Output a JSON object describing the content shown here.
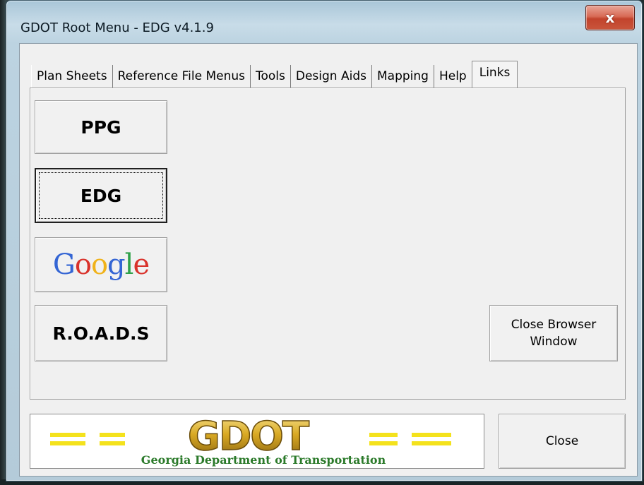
{
  "window": {
    "title": "GDOT Root Menu - EDG v4.1.9",
    "close_glyph": "x"
  },
  "tabs": [
    {
      "label": "Plan Sheets",
      "active": false
    },
    {
      "label": "Reference File Menus",
      "active": false
    },
    {
      "label": "Tools",
      "active": false
    },
    {
      "label": "Design Aids",
      "active": false
    },
    {
      "label": "Mapping",
      "active": false
    },
    {
      "label": "Help",
      "active": false
    },
    {
      "label": "Links",
      "active": true
    }
  ],
  "links_panel": {
    "ppg_label": "PPG",
    "edg_label": "EDG",
    "google_letters": [
      "G",
      "o",
      "o",
      "g",
      "l",
      "e"
    ],
    "roads_label": "R.O.A.D.S",
    "close_browser_label_line1": "Close Browser",
    "close_browser_label_line2": "Window"
  },
  "footer": {
    "logo_wordmark": "GDOT",
    "logo_subtitle": "Georgia Department of Transportation",
    "close_label": "Close"
  },
  "colors": {
    "google": [
      "#3465d4",
      "#d9322b",
      "#f0b21a",
      "#3465d4",
      "#2fa14a",
      "#d9322b"
    ],
    "gdot_gold": "#d9a923",
    "gdot_green": "#2b7a2a",
    "gdot_yellow_dash": "#f4e21c"
  }
}
